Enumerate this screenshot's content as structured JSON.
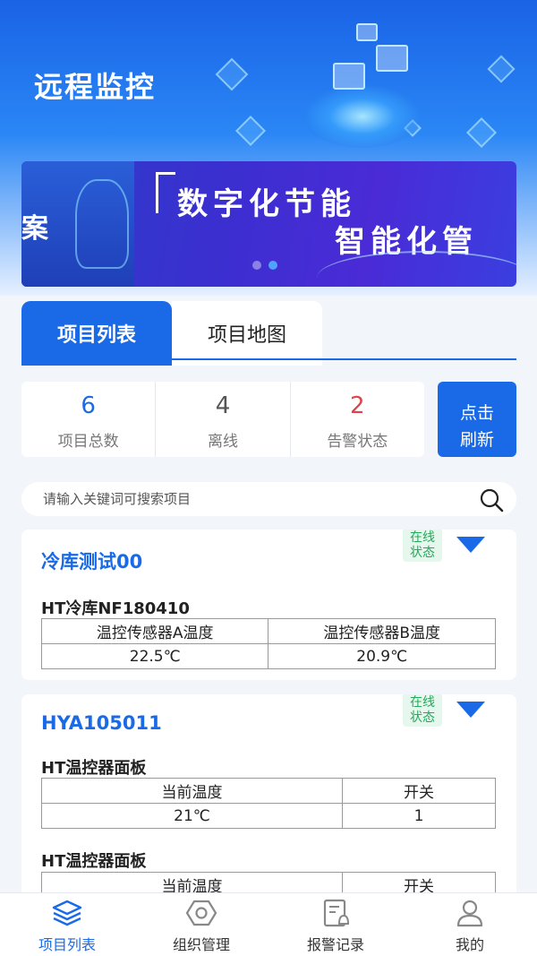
{
  "header": {
    "title": "远程监控"
  },
  "banner": {
    "left_text": "案",
    "line1": "数字化节能",
    "line2": "智能化管",
    "dots": 2,
    "active_dot": 1
  },
  "tabs": [
    {
      "label": "项目列表",
      "active": true
    },
    {
      "label": "项目地图",
      "active": false
    }
  ],
  "stats": {
    "total": {
      "value": "6",
      "label": "项目总数",
      "color": "#1a6ae8"
    },
    "offline": {
      "value": "4",
      "label": "离线",
      "color": "#555555"
    },
    "alarm": {
      "value": "2",
      "label": "告警状态",
      "color": "#e0434b"
    },
    "refresh_label_1": "点击",
    "refresh_label_2": "刷新"
  },
  "search": {
    "placeholder": "请输入关键词可搜索项目"
  },
  "projects": [
    {
      "name": "冷库测试00",
      "status_line1": "在线",
      "status_line2": "状态",
      "devices": [
        {
          "name": "HT冷库NF180410",
          "headers": [
            "温控传感器A温度",
            "温控传感器B温度"
          ],
          "values": [
            "22.5℃",
            "20.9℃"
          ]
        }
      ]
    },
    {
      "name": "HYA105011",
      "status_line1": "在线",
      "status_line2": "状态",
      "devices": [
        {
          "name": "HT温控器面板",
          "headers": [
            "当前温度",
            "开关"
          ],
          "values": [
            "21℃",
            "1"
          ]
        },
        {
          "name": "HT温控器面板",
          "headers": [
            "当前温度",
            "开关"
          ],
          "values": [
            "",
            ""
          ]
        }
      ]
    }
  ],
  "bottom_nav": [
    {
      "label": "项目列表",
      "icon": "layers-icon",
      "active": true
    },
    {
      "label": "组织管理",
      "icon": "hexagon-nut-icon",
      "active": false
    },
    {
      "label": "报警记录",
      "icon": "alarm-record-icon",
      "active": false
    },
    {
      "label": "我的",
      "icon": "user-icon",
      "active": false
    }
  ],
  "colors": {
    "primary": "#1a6ae8",
    "online": "#27a85a",
    "alarm": "#e0434b"
  }
}
